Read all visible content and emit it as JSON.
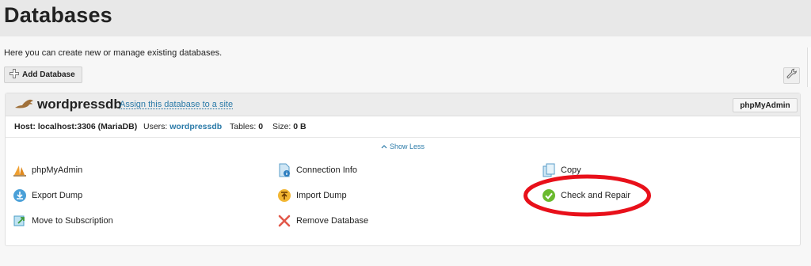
{
  "page": {
    "title": "Databases",
    "intro": "Here you can create new or manage existing databases."
  },
  "toolbar": {
    "add_label": "Add Database"
  },
  "database": {
    "name": "wordpressdb",
    "assign_link": "Assign this database to a site",
    "pma_button": "phpMyAdmin",
    "host_label": "Host:",
    "host_value": "localhost:3306 (MariaDB)",
    "users_label": "Users:",
    "users_value": "wordpressdb",
    "tables_label": "Tables:",
    "tables_value": "0",
    "size_label": "Size:",
    "size_value": "0 B"
  },
  "show_less": "Show Less",
  "tools": {
    "phpmyadmin": "phpMyAdmin",
    "connection_info": "Connection Info",
    "copy": "Copy",
    "export_dump": "Export Dump",
    "import_dump": "Import Dump",
    "check_repair": "Check and Repair",
    "move_subscription": "Move to Subscription",
    "remove_database": "Remove Database"
  },
  "icons": {
    "add": "plus-icon",
    "wrench": "wrench-icon",
    "seal": "mariadb-seal-icon",
    "sail": "phpmyadmin-sail-icon",
    "doc_info": "document-info-icon",
    "copy": "copy-icon",
    "export": "download-icon",
    "import": "upload-icon",
    "check": "checkmark-icon",
    "move": "move-icon",
    "remove": "x-icon",
    "chevron": "chevron-up-icon"
  },
  "colors": {
    "link": "#2a7aa8",
    "highlight": "#e8101a",
    "check": "#6aba2e"
  }
}
